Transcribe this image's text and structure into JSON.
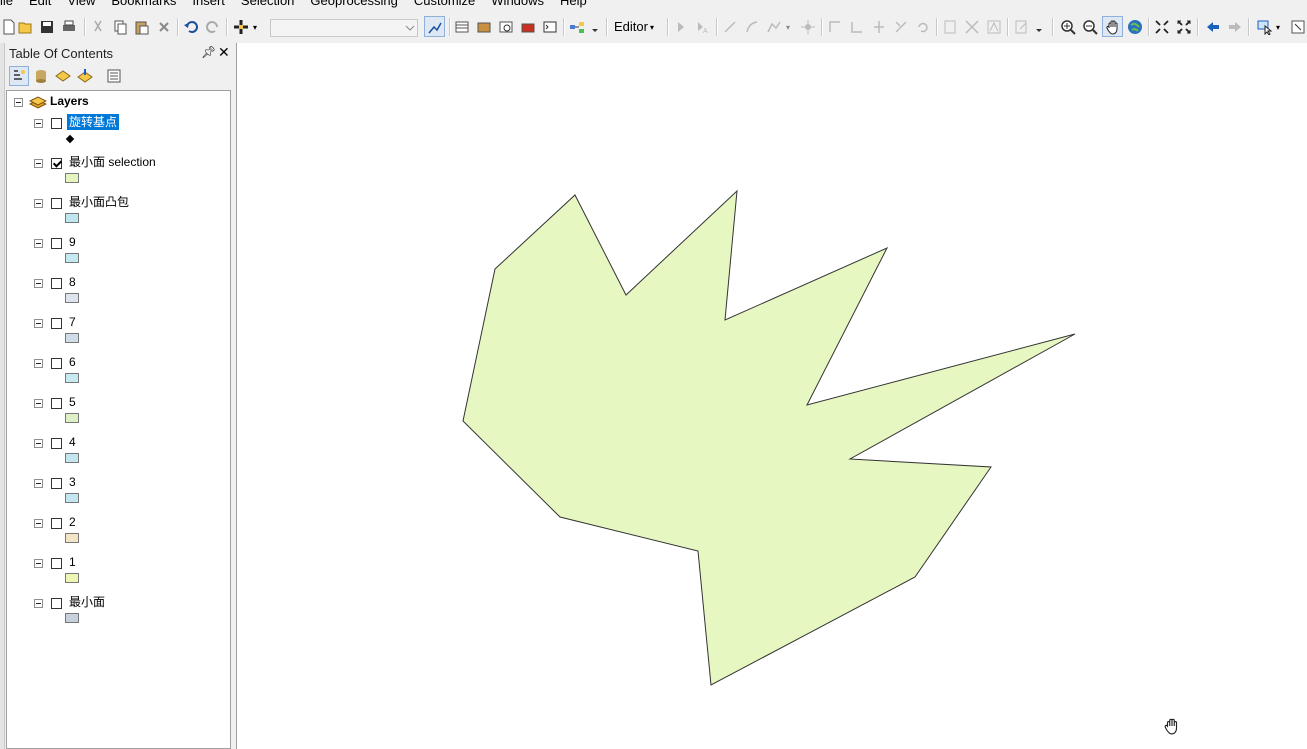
{
  "menu": [
    "ile",
    "Edit",
    "View",
    "Bookmarks",
    "Insert",
    "Selection",
    "Geoprocessing",
    "Customize",
    "Windows",
    "Help"
  ],
  "toolbar": {
    "editor_label": "Editor"
  },
  "toc": {
    "title": "Table Of Contents",
    "root_label": "Layers",
    "layers": [
      {
        "name": "旋转基点",
        "checked": false,
        "selected": true,
        "symbol": "point"
      },
      {
        "name": "最小面 selection",
        "checked": true,
        "symbol_color": "#e6f5c0"
      },
      {
        "name": "最小面凸包",
        "checked": false,
        "symbol_color": "#bde6ee"
      },
      {
        "name": "9",
        "checked": false,
        "symbol_color": "#c2eaf0"
      },
      {
        "name": "8",
        "checked": false,
        "symbol_color": "#dde4ec"
      },
      {
        "name": "7",
        "checked": false,
        "symbol_color": "#d0dce8"
      },
      {
        "name": "6",
        "checked": false,
        "symbol_color": "#c6eaf0"
      },
      {
        "name": "5",
        "checked": false,
        "symbol_color": "#ddf0c6"
      },
      {
        "name": "4",
        "checked": false,
        "symbol_color": "#c4e4ee"
      },
      {
        "name": "3",
        "checked": false,
        "symbol_color": "#c4e6f0"
      },
      {
        "name": "2",
        "checked": false,
        "symbol_color": "#f2e4c6"
      },
      {
        "name": "1",
        "checked": false,
        "symbol_color": "#eef6b4"
      },
      {
        "name": "最小面",
        "checked": false,
        "symbol_color": "#c8d0dc"
      }
    ]
  },
  "map": {
    "polygon_fill": "#e6f7c1",
    "polygon_stroke": "#333333"
  },
  "icons": [
    "new-icon",
    "open-icon",
    "save-icon",
    "print-icon",
    "cut-icon",
    "copy-icon",
    "paste-icon",
    "delete-icon",
    "undo-icon",
    "redo-icon",
    "add-data-icon",
    "zoom-in-icon",
    "zoom-out-icon",
    "pan-icon",
    "full-extent-icon",
    "back-icon",
    "forward-icon",
    "select-icon",
    "hand-cursor-icon"
  ]
}
